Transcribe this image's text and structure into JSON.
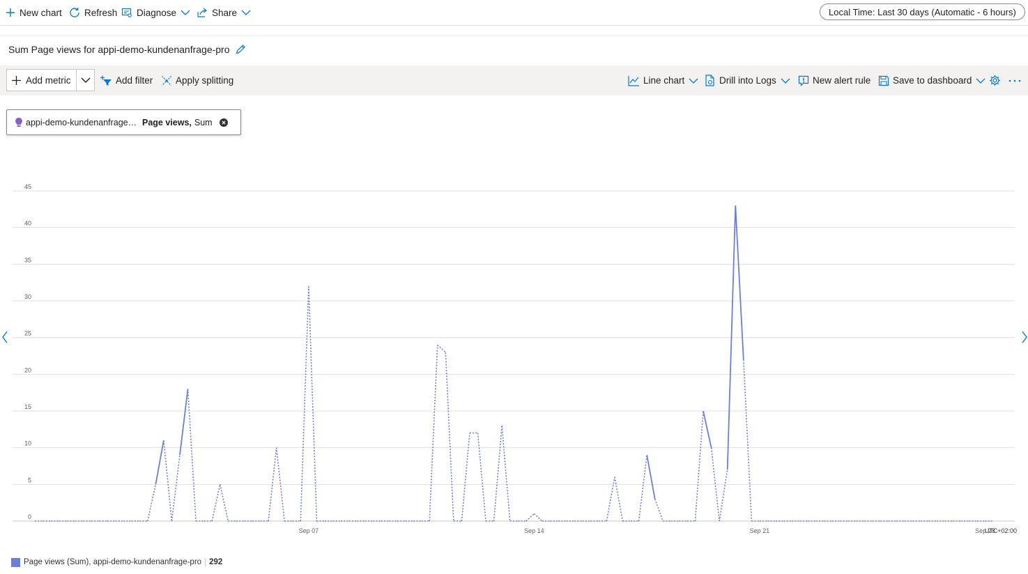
{
  "topbar": {
    "new_chart": "New chart",
    "refresh": "Refresh",
    "diagnose": "Diagnose",
    "share": "Share",
    "time_range": "Local Time: Last 30 days (Automatic - 6 hours)"
  },
  "chart_title": "Sum Page views for appi-demo-kundenanfrage-pro",
  "toolbar": {
    "add_metric": "Add metric",
    "add_filter": "Add filter",
    "apply_splitting": "Apply splitting",
    "line_chart": "Line chart",
    "drill_into_logs": "Drill into Logs",
    "new_alert_rule": "New alert rule",
    "save_to_dashboard": "Save to dashboard"
  },
  "metric_pill": {
    "resource": "appi-demo-kundenanfrage-pro",
    "metric": "Page views,",
    "aggregation": "Sum"
  },
  "colors": {
    "accent": "#0078d4",
    "series": "#6b7fd7"
  },
  "chart_data": {
    "type": "line",
    "ylim": [
      0,
      45
    ],
    "yticks": [
      0,
      5,
      10,
      15,
      20,
      25,
      30,
      35,
      40,
      45
    ],
    "xticks": [
      {
        "label": "Sep 07",
        "x": 34
      },
      {
        "label": "Sep 14",
        "x": 62
      },
      {
        "label": "Sep 21",
        "x": 90
      },
      {
        "label": "Sep 28",
        "x": 118
      }
    ],
    "timezone_label": "UTC+02:00",
    "xlim": [
      0,
      120
    ],
    "series": [
      {
        "name": "Page views (Sum), appi-demo-kundenanfrage-pro",
        "total": "292",
        "points": [
          [
            0,
            0
          ],
          [
            1,
            0
          ],
          [
            2,
            0
          ],
          [
            3,
            0
          ],
          [
            4,
            0
          ],
          [
            5,
            0
          ],
          [
            6,
            0
          ],
          [
            7,
            0
          ],
          [
            8,
            0
          ],
          [
            9,
            0
          ],
          [
            10,
            0
          ],
          [
            11,
            0
          ],
          [
            12,
            0
          ],
          [
            13,
            0
          ],
          [
            14,
            0
          ],
          [
            15,
            5
          ],
          [
            16,
            11
          ],
          [
            17,
            0
          ],
          [
            18,
            9
          ],
          [
            19,
            18
          ],
          [
            20,
            0
          ],
          [
            21,
            0
          ],
          [
            22,
            0
          ],
          [
            23,
            5
          ],
          [
            24,
            0
          ],
          [
            25,
            0
          ],
          [
            26,
            0
          ],
          [
            27,
            0
          ],
          [
            28,
            0
          ],
          [
            29,
            0
          ],
          [
            30,
            10
          ],
          [
            31,
            0
          ],
          [
            32,
            0
          ],
          [
            33,
            0
          ],
          [
            34,
            32
          ],
          [
            35,
            0
          ],
          [
            36,
            0
          ],
          [
            37,
            0
          ],
          [
            38,
            0
          ],
          [
            39,
            0
          ],
          [
            40,
            0
          ],
          [
            41,
            0
          ],
          [
            42,
            0
          ],
          [
            43,
            0
          ],
          [
            44,
            0
          ],
          [
            45,
            0
          ],
          [
            46,
            0
          ],
          [
            47,
            0
          ],
          [
            48,
            0
          ],
          [
            49,
            0
          ],
          [
            50,
            24
          ],
          [
            51,
            23
          ],
          [
            52,
            0
          ],
          [
            53,
            0
          ],
          [
            54,
            12
          ],
          [
            55,
            12
          ],
          [
            56,
            0
          ],
          [
            57,
            0
          ],
          [
            58,
            13
          ],
          [
            59,
            0
          ],
          [
            60,
            0
          ],
          [
            61,
            0
          ],
          [
            62,
            1
          ],
          [
            63,
            0
          ],
          [
            64,
            0
          ],
          [
            65,
            0
          ],
          [
            66,
            0
          ],
          [
            67,
            0
          ],
          [
            68,
            0
          ],
          [
            69,
            0
          ],
          [
            70,
            0
          ],
          [
            71,
            0
          ],
          [
            72,
            6
          ],
          [
            73,
            0
          ],
          [
            74,
            0
          ],
          [
            75,
            0
          ],
          [
            76,
            9
          ],
          [
            77,
            3
          ],
          [
            78,
            0
          ],
          [
            79,
            0
          ],
          [
            80,
            0
          ],
          [
            81,
            0
          ],
          [
            82,
            0
          ],
          [
            83,
            15
          ],
          [
            84,
            10
          ],
          [
            85,
            0
          ],
          [
            86,
            7
          ],
          [
            87,
            43
          ],
          [
            88,
            22
          ],
          [
            89,
            0
          ],
          [
            90,
            0
          ],
          [
            91,
            0
          ],
          [
            92,
            0
          ],
          [
            93,
            0
          ],
          [
            94,
            0
          ],
          [
            95,
            0
          ],
          [
            96,
            0
          ],
          [
            97,
            0
          ],
          [
            98,
            0
          ],
          [
            99,
            0
          ],
          [
            100,
            0
          ],
          [
            101,
            0
          ],
          [
            102,
            0
          ],
          [
            103,
            0
          ],
          [
            104,
            0
          ],
          [
            105,
            0
          ],
          [
            106,
            0
          ],
          [
            107,
            0
          ],
          [
            108,
            0
          ],
          [
            109,
            0
          ],
          [
            110,
            0
          ],
          [
            111,
            0
          ],
          [
            112,
            0
          ],
          [
            113,
            0
          ],
          [
            114,
            0
          ],
          [
            115,
            0
          ],
          [
            116,
            0
          ],
          [
            117,
            0
          ],
          [
            118,
            0
          ],
          [
            119,
            0
          ]
        ],
        "solid_segments": [
          [
            15,
            16
          ],
          [
            18,
            19
          ],
          [
            76,
            77
          ],
          [
            83,
            84
          ],
          [
            86,
            87
          ],
          [
            87,
            88
          ]
        ]
      }
    ]
  }
}
